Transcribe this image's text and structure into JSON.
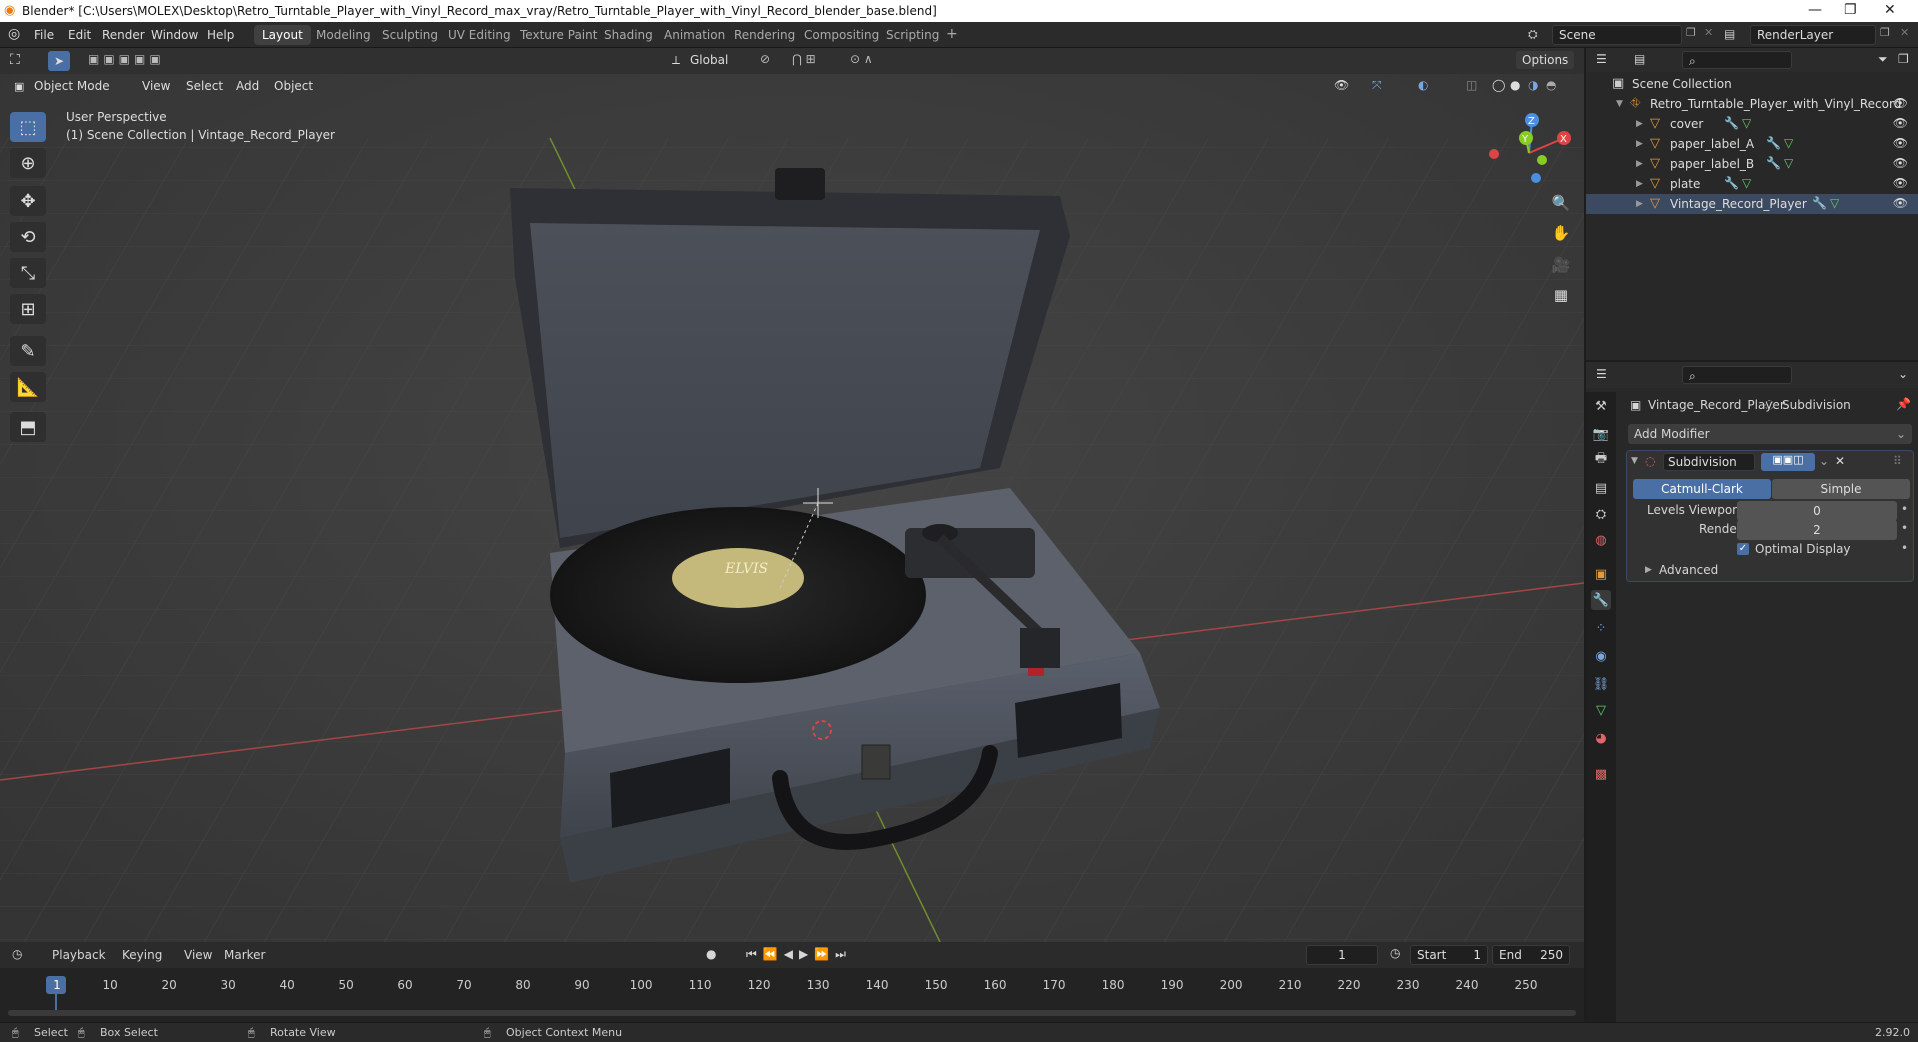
{
  "window": {
    "title": "Blender* [C:\\Users\\MOLEX\\Desktop\\Retro_Turntable_Player_with_Vinyl_Record_max_vray/Retro_Turntable_Player_with_Vinyl_Record_blender_base.blend]"
  },
  "menu": [
    "File",
    "Edit",
    "Render",
    "Window",
    "Help"
  ],
  "workspaces": [
    "Layout",
    "Modeling",
    "Sculpting",
    "UV Editing",
    "Texture Paint",
    "Shading",
    "Animation",
    "Rendering",
    "Compositing",
    "Scripting"
  ],
  "active_workspace": "Layout",
  "scene": "Scene",
  "view_layer": "RenderLayer",
  "viewport": {
    "orientation": "Global",
    "options": "Options",
    "mode": "Object Mode",
    "header_menus": [
      "View",
      "Select",
      "Add",
      "Object"
    ],
    "perspective": "User Perspective",
    "collection_info": "(1) Scene Collection | Vintage_Record_Player",
    "gizmo": {
      "z": "Z",
      "y": "Y",
      "x": "X"
    },
    "record_label": "ELVIS"
  },
  "outliner": {
    "root": "Scene Collection",
    "collection": "Retro_Turntable_Player_with_Vinyl_Record",
    "items": [
      "cover",
      "paper_label_A",
      "paper_label_B",
      "plate",
      "Vintage_Record_Player"
    ]
  },
  "properties": {
    "object": "Vintage_Record_Player",
    "modifier_crumb": "Subdivision",
    "add_modifier": "Add Modifier",
    "modifier": {
      "name": "Subdivision",
      "type_catmull": "Catmull-Clark",
      "type_simple": "Simple",
      "levels_label": "Levels Viewport",
      "levels_value": "0",
      "render_label": "Render",
      "render_value": "2",
      "optimal_display": "Optimal Display",
      "advanced": "Advanced"
    }
  },
  "timeline": {
    "menus": [
      "Playback",
      "Keying",
      "View",
      "Marker"
    ],
    "current_frame": "1",
    "start_label": "Start",
    "start": "1",
    "end_label": "End",
    "end": "250",
    "ticks": [
      "1",
      "10",
      "20",
      "30",
      "40",
      "50",
      "60",
      "70",
      "80",
      "90",
      "100",
      "110",
      "120",
      "130",
      "140",
      "150",
      "160",
      "170",
      "180",
      "190",
      "200",
      "210",
      "220",
      "230",
      "240",
      "250"
    ]
  },
  "statusbar": {
    "select": "Select",
    "box_select": "Box Select",
    "rotate": "Rotate View",
    "context": "Object Context Menu",
    "version": "2.92.0"
  }
}
